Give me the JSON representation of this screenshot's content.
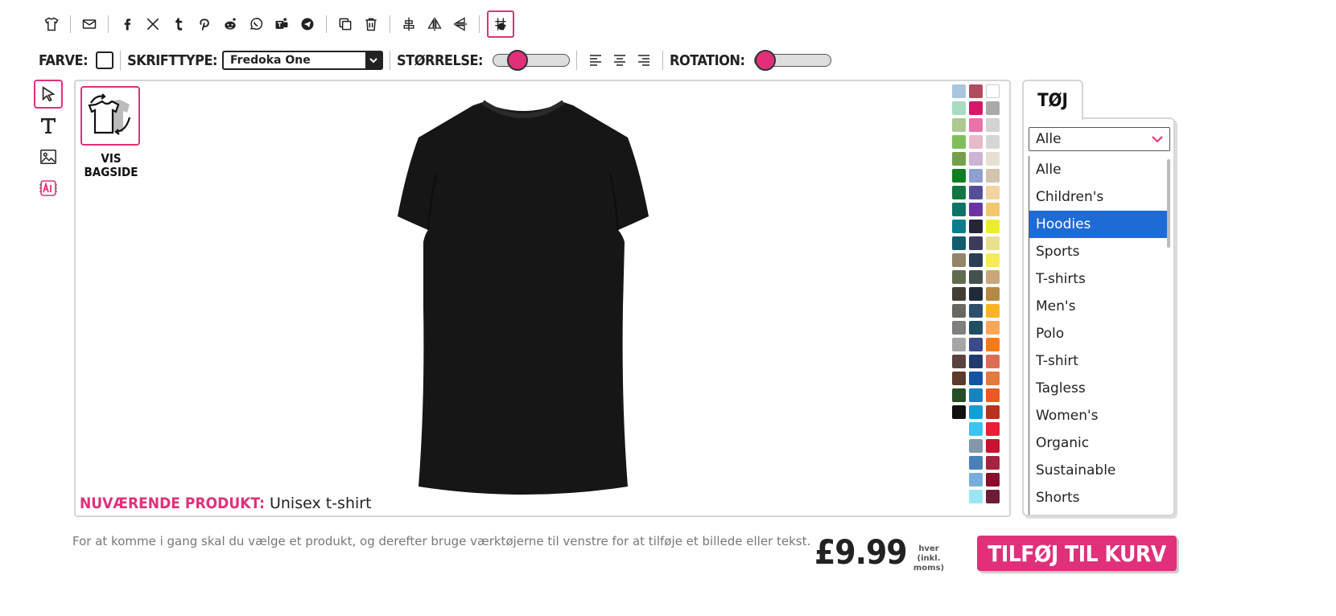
{
  "toolbar": {
    "icons": [
      "tshirt-icon",
      "email-icon",
      "facebook-icon",
      "x-icon",
      "tumblr-icon",
      "pinterest-icon",
      "reddit-icon",
      "whatsapp-icon",
      "teams-icon",
      "telegram-icon",
      "duplicate-icon",
      "trash-icon",
      "center-align-icon",
      "flip-horizontal-icon",
      "flip-vertical-icon",
      "grid-icon"
    ]
  },
  "options": {
    "color_label": "FARVE:",
    "font_label": "SKRIFTTYPE:",
    "font_value": "Fredoka One",
    "size_label": "STØRRELSE:",
    "size_level": 0.25,
    "rotation_label": "ROTATION:",
    "rotation_level": 0.0
  },
  "canvas": {
    "back_label_line1": "VIS",
    "back_label_line2": "BAGSIDE",
    "current_product_label": "NUVÆRENDE PRODUKT:",
    "current_product_value": "Unisex t-shirt"
  },
  "swatches": {
    "col1": [
      "#a9c6dd",
      "#a8dcc0",
      "#adc893",
      "#7fbf5a",
      "#74a04a",
      "#0f7e23",
      "#137642",
      "#0e7566",
      "#0a7d8a",
      "#125c6c",
      "#948468",
      "#5f6d4e",
      "#433e33",
      "#6a6660",
      "#7f7f7f",
      "#a6a6a6",
      "#5a4240",
      "#5c3b2d",
      "#264d26",
      "#111111"
    ],
    "col2": [
      "#b34b5e",
      "#d6196a",
      "#ea71aa",
      "#e7b9c9",
      "#cdb3d4",
      "#8e9fd0",
      "#554f99",
      "#6a35a0",
      "#252538",
      "#3b3c5c",
      "#2c3e55",
      "#44514c",
      "#1f2a3a",
      "#2e4e6c",
      "#1f4e62",
      "#3a4a8a",
      "#1f3a6c",
      "#1553a3",
      "#1784c2",
      "#10a0d8",
      "#3bc5ee",
      "#8297a7",
      "#4a7fb7",
      "#78acdc",
      "#9be6f5"
    ],
    "col3": [
      "#ffffff",
      "#aaaaaa",
      "#d3d3d3",
      "#d6d6d6",
      "#e8dfd3",
      "#d3c3af",
      "#f3d3a0",
      "#f2c76d",
      "#eaee2e",
      "#e8e08b",
      "#f6ea5a",
      "#c9a67a",
      "#b68944",
      "#fbb324",
      "#f9a55a",
      "#fb7a16",
      "#df6c54",
      "#e5793e",
      "#ec5a22",
      "#b8311e",
      "#e81f35",
      "#c71231",
      "#a72140",
      "#8b0c2c",
      "#6a1d35"
    ]
  },
  "panel": {
    "tab_label": "TØJ",
    "select_value": "Alle",
    "options": [
      "Alle",
      "Children's",
      "Hoodies",
      "Sports",
      "T-shirts",
      "Men's",
      "Polo",
      "T-shirt",
      "Tagless",
      "Women's",
      "Organic",
      "Sustainable",
      "Shorts"
    ],
    "selected_option": "Hoodies"
  },
  "footer": {
    "hint": "For at komme i gang skal du vælge et produkt, og derefter bruge værktøjerne til venstre for at tilføje et billede eller tekst.",
    "price": "£9.99",
    "price_note_line1": "hver (inkl.",
    "price_note_line2": "moms)",
    "cart_button": "TILFØJ TIL KURV"
  },
  "colors": {
    "accent": "#e0307a",
    "selection": "#1e6bd6"
  }
}
